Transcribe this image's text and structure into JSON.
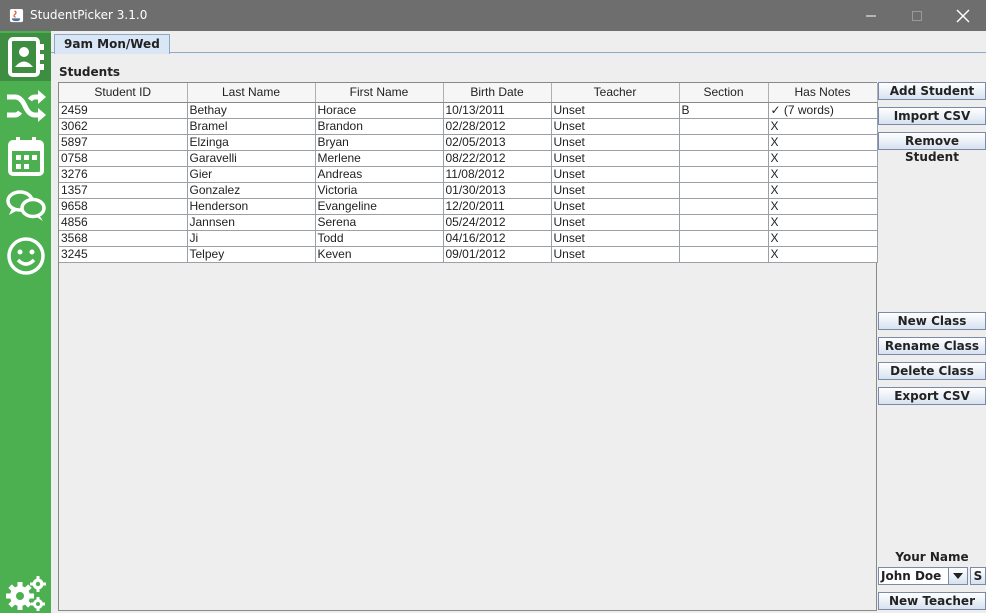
{
  "window": {
    "title": "StudentPicker 3.1.0"
  },
  "sidebar": {
    "items": [
      {
        "icon": "contact-book-icon",
        "active": true
      },
      {
        "icon": "shuffle-icon",
        "active": false
      },
      {
        "icon": "calendar-icon",
        "active": false
      },
      {
        "icon": "chat-bubbles-icon",
        "active": false
      },
      {
        "icon": "smiley-icon",
        "active": false
      }
    ],
    "settings_icon": "settings-gears-icon"
  },
  "tabs": [
    {
      "label": "9am Mon/Wed",
      "active": true
    }
  ],
  "students_label": "Students",
  "table": {
    "columns": [
      "Student ID",
      "Last Name",
      "First Name",
      "Birth Date",
      "Teacher",
      "Section",
      "Has Notes"
    ],
    "rows": [
      [
        "2459",
        "Bethay",
        "Horace",
        "10/13/2011",
        "Unset",
        "B",
        "✓ (7 words)"
      ],
      [
        "3062",
        "Bramel",
        "Brandon",
        "02/28/2012",
        "Unset",
        "",
        "X"
      ],
      [
        "5897",
        "Elzinga",
        "Bryan",
        "02/05/2013",
        "Unset",
        "",
        "X"
      ],
      [
        "0758",
        "Garavelli",
        "Merlene",
        "08/22/2012",
        "Unset",
        "",
        "X"
      ],
      [
        "3276",
        "Gier",
        "Andreas",
        "11/08/2012",
        "Unset",
        "",
        "X"
      ],
      [
        "1357",
        "Gonzalez",
        "Victoria",
        "01/30/2013",
        "Unset",
        "",
        "X"
      ],
      [
        "9658",
        "Henderson",
        "Evangeline",
        "12/20/2011",
        "Unset",
        "",
        "X"
      ],
      [
        "4856",
        "Jannsen",
        "Serena",
        "05/24/2012",
        "Unset",
        "",
        "X"
      ],
      [
        "3568",
        "Ji",
        "Todd",
        "04/16/2012",
        "Unset",
        "",
        "X"
      ],
      [
        "3245",
        "Telpey",
        "Keven",
        "09/01/2012",
        "Unset",
        "",
        "X"
      ]
    ]
  },
  "buttons": {
    "add_student": "Add Student",
    "import_csv": "Import CSV",
    "remove_student": "Remove Student",
    "new_class": "New Class",
    "rename_class": "Rename Class",
    "delete_class": "Delete Class",
    "export_csv": "Export CSV",
    "new_teacher": "New Teacher",
    "small": "S"
  },
  "your_name": {
    "label": "Your Name",
    "selected": "John Doe"
  },
  "colors": {
    "sidebar": "#4caf50",
    "sidebar_active": "#3d8e40",
    "titlebar": "#6e6e6e"
  }
}
